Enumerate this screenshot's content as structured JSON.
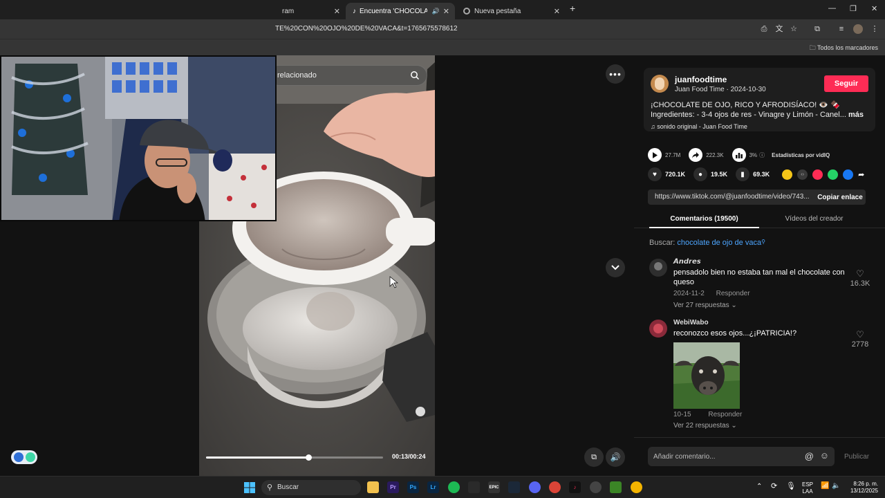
{
  "tabs": [
    {
      "label": "ram"
    },
    {
      "label": "Encuentra 'CHOCOLATE CO"
    },
    {
      "label": "Nueva pestaña"
    }
  ],
  "address": {
    "url": "TE%20CON%20OJO%20DE%20VACA&t=1765675578612"
  },
  "bookmarks": {
    "all_label": "Todos los marcadores"
  },
  "video": {
    "search_text": "relacionado",
    "time": "00:13/00:24",
    "progress_fraction": 0.58
  },
  "creator": {
    "username": "juanfoodtime",
    "subline": "Juan Food Time · 2024-10-30",
    "follow_label": "Seguir",
    "description": "¡CHOCOLATE DE OJO, RICO Y AFRODISÍACO! 👁️ 🍫 Ingredientes: - 3-4 ojos de res - Vinagre y Limón - Canel...",
    "more_label": "más",
    "music": "sonido original - Juan Food Time"
  },
  "stats": {
    "plays": "27.7M",
    "shares": "222.3K",
    "percent": "3%",
    "vidiq_label": "Estadísticas por vidIQ",
    "likes": "720.1K",
    "comments": "19.5K",
    "saves": "69.3K"
  },
  "share": {
    "link": "https://www.tiktok.com/@juanfoodtime/video/743...",
    "copy_label": "Copiar enlace"
  },
  "panel_tabs": {
    "comments": "Comentarios (19500)",
    "creator_videos": "Vídeos del creador"
  },
  "search_line": {
    "prefix": "Buscar:",
    "keyword": "chocolate de ojo de vaca"
  },
  "comments": [
    {
      "name": "𝘼𝙣𝙙𝙧𝙚𝙨",
      "text": "pensadolo bien no estaba tan mal el chocolate con queso",
      "date": "2024-11-2",
      "reply": "Responder",
      "replies": "Ver 27 respuestas",
      "likes": "16.3K"
    },
    {
      "name": "WebiWabo",
      "text": "reconozco esos ojos...¿¡PATRICIA!?",
      "date": "10-15",
      "reply": "Responder",
      "replies": "Ver 22 respuestas",
      "likes": "2778"
    }
  ],
  "comment_bar": {
    "placeholder": "Añadir comentario...",
    "publish": "Publicar"
  },
  "taskbar": {
    "search": "Buscar",
    "lang": "ESP",
    "lang2": "LAA",
    "time": "8:26 p. m.",
    "date": "13/12/2025"
  },
  "colors": {
    "accent": "#fe2c55",
    "link": "#4da6ff"
  }
}
